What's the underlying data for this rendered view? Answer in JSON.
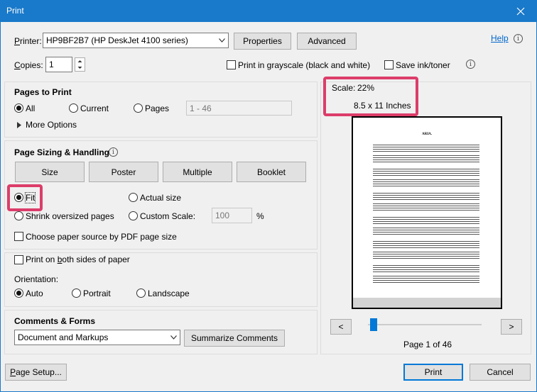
{
  "window": {
    "title": "Print"
  },
  "printer": {
    "label": "Printer:",
    "selected": "HP9BF2B7 (HP DeskJet 4100 series)",
    "properties_label": "Properties",
    "advanced_label": "Advanced",
    "help_label": "Help"
  },
  "copies": {
    "label": "Copies:",
    "value": "1",
    "grayscale_label": "Print in grayscale (black and white)",
    "save_ink_label": "Save ink/toner"
  },
  "pages_to_print": {
    "title": "Pages to Print",
    "all_label": "All",
    "current_label": "Current",
    "pages_label": "Pages",
    "pages_value": "1 - 46",
    "more_options_label": "More Options"
  },
  "sizing": {
    "title": "Page Sizing & Handling",
    "tabs": [
      "Size",
      "Poster",
      "Multiple",
      "Booklet"
    ],
    "fit_label": "Fit",
    "actual_size_label": "Actual size",
    "shrink_label": "Shrink oversized pages",
    "custom_scale_label": "Custom Scale:",
    "custom_scale_value": "100",
    "percent_label": "%",
    "paper_source_label": "Choose paper source by PDF page size"
  },
  "duplex": {
    "both_sides_label": "Print on both sides of paper",
    "orientation_label": "Orientation:",
    "auto_label": "Auto",
    "portrait_label": "Portrait",
    "landscape_label": "Landscape"
  },
  "comments": {
    "title": "Comments & Forms",
    "selected": "Document and Markups",
    "summarize_label": "Summarize Comments"
  },
  "preview": {
    "scale_label": "Scale:",
    "scale_value": "22%",
    "paper_size": "8.5 x 11 Inches",
    "sheet_title": "ARIA.",
    "prev_label": "<",
    "next_label": ">",
    "page_indicator": "Page 1 of 46",
    "slider_position": 0
  },
  "footer": {
    "page_setup_label": "Page Setup...",
    "print_label": "Print",
    "cancel_label": "Cancel"
  },
  "colors": {
    "title_bar": "#1979ca",
    "highlight": "#dc3d6a",
    "link": "#0066cc",
    "slider": "#0078d7"
  }
}
